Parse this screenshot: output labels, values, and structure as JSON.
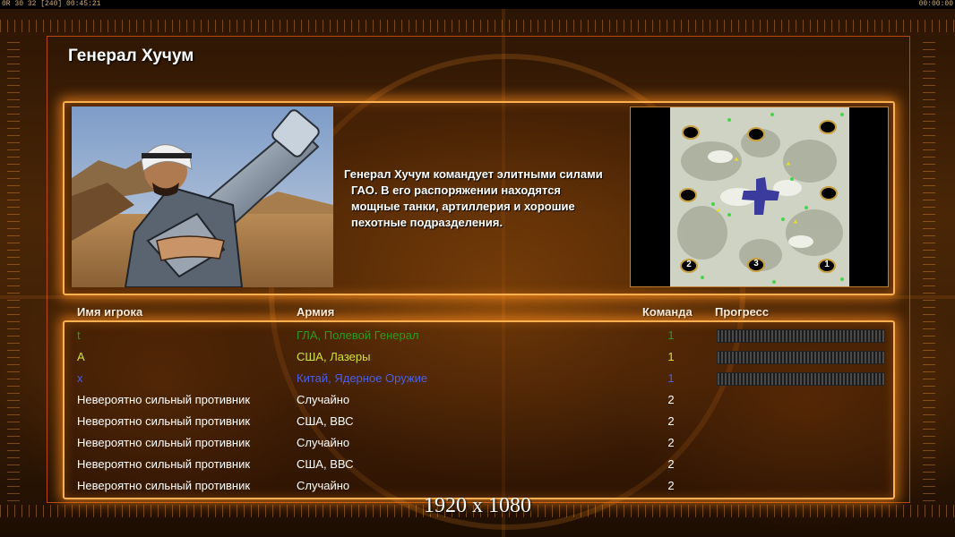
{
  "hud": {
    "left_readout": "0R 30 32 [240] 00:45:21",
    "right_readout": "00:00:00"
  },
  "general": {
    "name": "Генерал Хучум",
    "description_lines": [
      "Генерал Хучум командует элитными силами",
      "ГАО. В его распоряжении находятся",
      "мощные танки, артиллерия и хорошие",
      "пехотные подразделения."
    ]
  },
  "map": {
    "start_positions": [
      "2",
      "3",
      "1"
    ]
  },
  "table": {
    "headers": {
      "player": "Имя игрока",
      "army": "Армия",
      "team": "Команда",
      "progress": "Прогресс"
    },
    "rows": [
      {
        "player": "t",
        "army": "ГЛА, Полевой Генерал",
        "team": "1",
        "color": "#2f9a1e",
        "has_progress": true
      },
      {
        "player": "A",
        "army": "США, Лазеры",
        "team": "1",
        "color": "#d2e23a",
        "has_progress": true
      },
      {
        "player": "x",
        "army": "Китай, Ядерное Оружие",
        "team": "1",
        "color": "#4a5fe6",
        "has_progress": true
      },
      {
        "player": "Невероятно сильный противник",
        "army": "Случайно",
        "team": "2",
        "color": "#ffffff",
        "has_progress": false
      },
      {
        "player": "Невероятно сильный противник",
        "army": "США, ВВС",
        "team": "2",
        "color": "#ffffff",
        "has_progress": false
      },
      {
        "player": "Невероятно сильный противник",
        "army": "Случайно",
        "team": "2",
        "color": "#ffffff",
        "has_progress": false
      },
      {
        "player": "Невероятно сильный противник",
        "army": "США, ВВС",
        "team": "2",
        "color": "#ffffff",
        "has_progress": false
      },
      {
        "player": "Невероятно сильный противник",
        "army": "Случайно",
        "team": "2",
        "color": "#ffffff",
        "has_progress": false
      }
    ]
  },
  "watermark": "1920 x 1080"
}
